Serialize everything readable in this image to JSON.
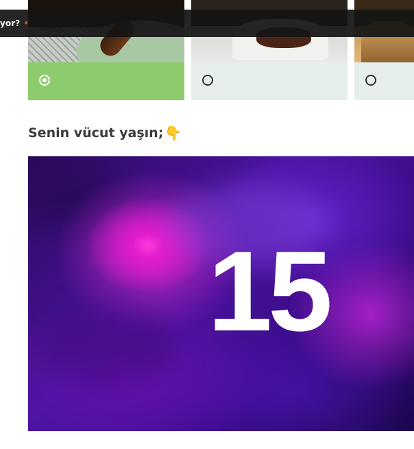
{
  "topbar": {
    "text": "yor?",
    "dot": "•",
    "dot_color": "#e0433f"
  },
  "options": [
    {
      "image": "eclair-dessert",
      "selected": true,
      "footer_color": "#8dcc6c"
    },
    {
      "image": "brownie-dessert",
      "selected": false,
      "footer_color": "#e6eeee"
    },
    {
      "image": "caramel-dessert",
      "selected": false,
      "footer_color": "#e6eeee"
    }
  ],
  "question": {
    "heading": "Senin vücut yaşın;",
    "emoji_icon": "pointing-down-hand-icon",
    "emoji": "👇"
  },
  "result": {
    "age": "15",
    "background": "purple-nebula"
  }
}
